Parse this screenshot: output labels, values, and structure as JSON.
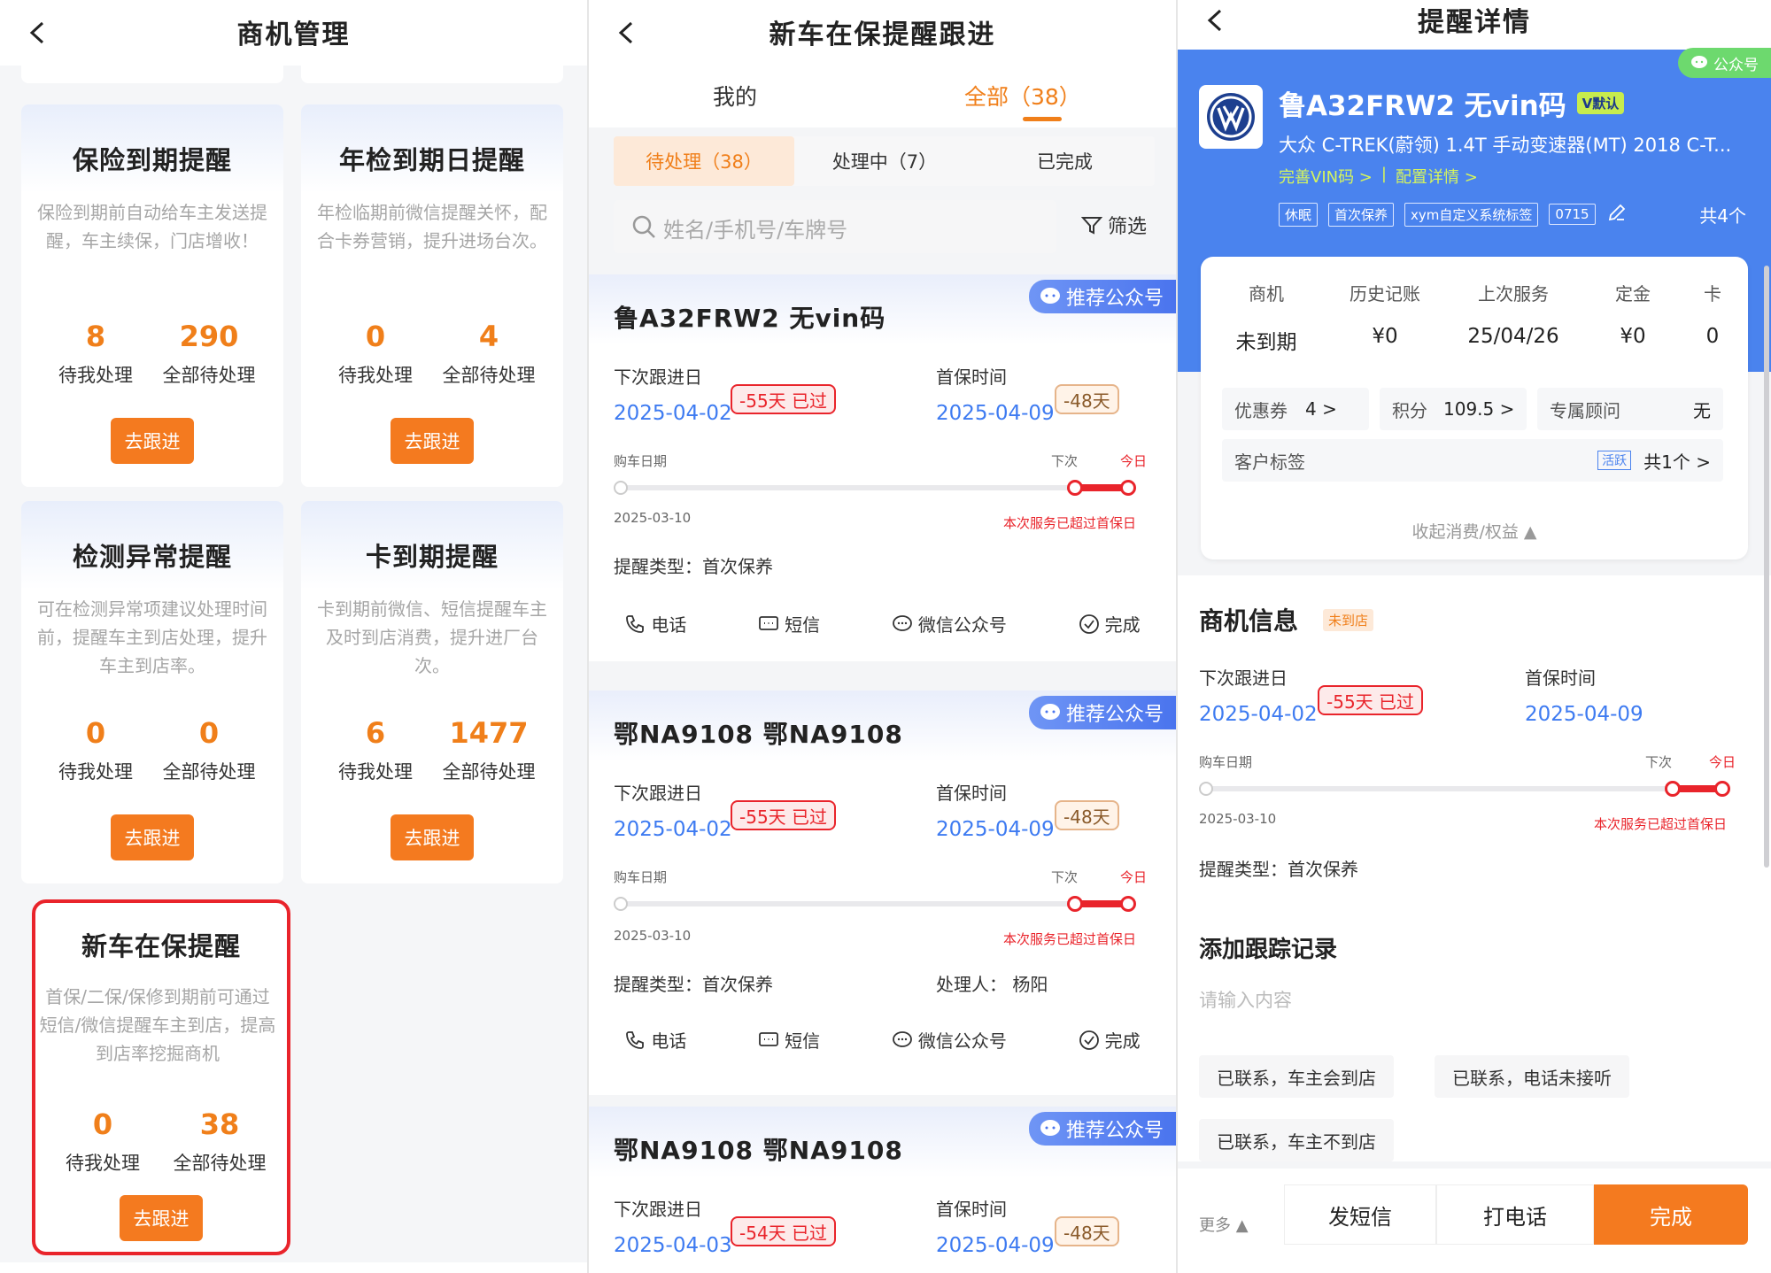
{
  "colors": {
    "accent": "#f07f1a",
    "blue": "#3e7bf1",
    "red": "#e9242b",
    "header_blue": "#4a83ee"
  },
  "panel1": {
    "title": "商机管理",
    "cards": [
      {
        "title": "保险到期提醒",
        "desc": "保险到期前自动给车主发送提醒，车主续保，门店增收！",
        "mine_num": "8",
        "mine_label": "待我处理",
        "all_num": "290",
        "all_label": "全部待处理",
        "button": "去跟进"
      },
      {
        "title": "年检到期日提醒",
        "desc": "年检临期前微信提醒关怀，配合卡券营销，提升进场台次。",
        "mine_num": "0",
        "mine_label": "待我处理",
        "all_num": "4",
        "all_label": "全部待处理",
        "button": "去跟进"
      },
      {
        "title": "检测异常提醒",
        "desc": "可在检测异常项建议处理时间前，提醒车主到店处理，提升车主到店率。",
        "mine_num": "0",
        "mine_label": "待我处理",
        "all_num": "0",
        "all_label": "全部待处理",
        "button": "去跟进"
      },
      {
        "title": "卡到期提醒",
        "desc": "卡到期前微信、短信提醒车主及时到店消费，提升进厂台次。",
        "mine_num": "6",
        "mine_label": "待我处理",
        "all_num": "1477",
        "all_label": "全部待处理",
        "button": "去跟进"
      },
      {
        "title": "新车在保提醒",
        "desc": "首保/二保/保修到期前可通过短信/微信提醒车主到店，提高到店率挖掘商机",
        "mine_num": "0",
        "mine_label": "待我处理",
        "all_num": "38",
        "all_label": "全部待处理",
        "button": "去跟进"
      }
    ]
  },
  "panel2": {
    "title": "新车在保提醒跟进",
    "tabs": [
      {
        "label": "我的"
      },
      {
        "label": "全部（38）"
      }
    ],
    "subtabs": [
      {
        "label": "待处理（38）"
      },
      {
        "label": "处理中（7）"
      },
      {
        "label": "已完成"
      }
    ],
    "search_placeholder": "姓名/手机号/车牌号",
    "filter_label": "筛选",
    "records": [
      {
        "plate": "鲁A32FRW2  无vin码",
        "badge": "推荐公众号",
        "next_label": "下次跟进日",
        "next_date": "2025-04-02",
        "overdue": "-55天 已过",
        "first_label": "首保时间",
        "first_date": "2025-04-09",
        "days": "-48天",
        "buy_label": "购车日期",
        "next_short": "下次",
        "today": "今日",
        "buy_date": "2025-03-10",
        "warn": "本次服务已超过首保日",
        "type_label": "提醒类型：",
        "type_value": "首次保养",
        "handler": "",
        "actions": [
          "电话",
          "短信",
          "微信公众号",
          "完成"
        ]
      },
      {
        "plate": "鄂NA9108  鄂NA9108",
        "badge": "推荐公众号",
        "next_label": "下次跟进日",
        "next_date": "2025-04-02",
        "overdue": "-55天 已过",
        "first_label": "首保时间",
        "first_date": "2025-04-09",
        "days": "-48天",
        "buy_label": "购车日期",
        "next_short": "下次",
        "today": "今日",
        "buy_date": "2025-03-10",
        "warn": "本次服务已超过首保日",
        "type_label": "提醒类型：",
        "type_value": "首次保养",
        "handler": "处理人：  杨阳",
        "actions": [
          "电话",
          "短信",
          "微信公众号",
          "完成"
        ]
      },
      {
        "plate": "鄂NA9108  鄂NA9108",
        "badge": "推荐公众号",
        "next_label": "下次跟进日",
        "next_date": "2025-04-03",
        "overdue": "-54天 已过",
        "first_label": "首保时间",
        "first_date": "2025-04-09",
        "days": "-48天"
      }
    ]
  },
  "panel3": {
    "title": "提醒详情",
    "gzh_badge": "公众号",
    "plate": "鲁A32FRW2 无vin码",
    "default_tag": "V默认",
    "model": "大众 C-TREK(蔚领) 1.4T 手动变速器(MT) 2018 C-T...",
    "link_vin": "完善VIN码 >",
    "link_sep": "|",
    "link_config": "配置详情 >",
    "tags": [
      "休眠",
      "首次保养",
      "xym自定义系统标签",
      "0715"
    ],
    "tag_count": "共4个",
    "info_cols": [
      {
        "h": "商机",
        "v": "未到期"
      },
      {
        "h": "历史记账",
        "v": "¥0"
      },
      {
        "h": "上次服务",
        "v": "25/04/26"
      },
      {
        "h": "定金",
        "v": "¥0"
      },
      {
        "h": "卡",
        "v": "0"
      }
    ],
    "coupon_label": "优惠券",
    "coupon_val": "4 >",
    "points_label": "积分",
    "points_val": "109.5 >",
    "advisor_label": "专属顾问",
    "advisor_val": "无",
    "customer_tag_label": "客户标签",
    "customer_tag_chip": "活跃",
    "customer_tag_count": "共1个 >",
    "fold_label": "收起消费/权益 ▲",
    "biz_title": "商机信息",
    "biz_tag": "未到店",
    "next_label": "下次跟进日",
    "next_date": "2025-04-02",
    "overdue": "-55天 已过",
    "first_label": "首保时间",
    "first_date": "2025-04-09",
    "buy_label": "购车日期",
    "next_short": "下次",
    "today": "今日",
    "buy_date": "2025-03-10",
    "warn": "本次服务已超过首保日",
    "type_label": "提醒类型：",
    "type_value": "首次保养",
    "track_title": "添加跟踪记录",
    "input_placeholder": "请输入内容",
    "quick_replies": [
      "已联系，车主会到店",
      "已联系，电话未接听",
      "已联系，车主不到店"
    ],
    "more": "更多 ▲",
    "btn_sms": "发短信",
    "btn_call": "打电话",
    "btn_done": "完成"
  }
}
